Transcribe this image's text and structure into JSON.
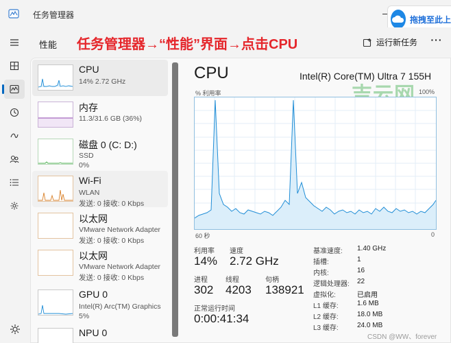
{
  "titlebar": {
    "title": "任务管理器",
    "overlay_text": "拖拽至此上"
  },
  "header": {
    "page_title": "性能",
    "annotation": "任务管理器→“性能”界面→点击CPU",
    "run_task_label": "运行新任务",
    "more_label": "···"
  },
  "nav": [
    {
      "icon": "hamburger-icon"
    },
    {
      "icon": "processes-icon"
    },
    {
      "icon": "performance-icon"
    },
    {
      "icon": "app-history-icon"
    },
    {
      "icon": "startup-icon"
    },
    {
      "icon": "users-icon"
    },
    {
      "icon": "details-icon"
    },
    {
      "icon": "services-icon"
    },
    {
      "icon": "settings-icon"
    }
  ],
  "sidebar": {
    "items": [
      {
        "name": "CPU",
        "line1": "14% 2.72 GHz",
        "line2": "",
        "color": "#1f8dd6"
      },
      {
        "name": "内存",
        "line1": "11.3/31.6 GB (36%)",
        "line2": "",
        "color": "#8e44ad"
      },
      {
        "name": "磁盘 0 (C: D:)",
        "line1": "SSD",
        "line2": "0%",
        "color": "#4caf50"
      },
      {
        "name": "Wi-Fi",
        "line1": "WLAN",
        "line2": "发送: 0 接收: 0 Kbps",
        "color": "#d9822b"
      },
      {
        "name": "以太网",
        "line1": "VMware Network Adapter",
        "line2": "发送: 0 接收: 0 Kbps",
        "color": "#d9822b"
      },
      {
        "name": "以太网",
        "line1": "VMware Network Adapter",
        "line2": "发送: 0 接收: 0 Kbps",
        "color": "#d9822b"
      },
      {
        "name": "GPU 0",
        "line1": "Intel(R) Arc(TM) Graphics",
        "line2": "5%",
        "color": "#1f8dd6"
      },
      {
        "name": "NPU 0",
        "line1": "",
        "line2": "",
        "color": "#1f8dd6"
      }
    ]
  },
  "detail": {
    "title": "CPU",
    "model": "Intel(R) Core(TM) Ultra 7 155H",
    "watermark": "吉云网",
    "util_label": "% 利用率",
    "util_max": "100%",
    "axis_left": "60 秒",
    "axis_right": "0",
    "usage_label": "利用率",
    "usage_value": "14%",
    "speed_label": "速度",
    "speed_value": "2.72 GHz",
    "processes_label": "进程",
    "processes_value": "302",
    "threads_label": "线程",
    "threads_value": "4203",
    "handles_label": "句柄",
    "handles_value": "138921",
    "uptime_label": "正常运行时间",
    "uptime_value": "0:00:41:34",
    "specs": [
      {
        "label": "基准速度:",
        "value": "1.40 GHz"
      },
      {
        "label": "插槽:",
        "value": "1"
      },
      {
        "label": "内核:",
        "value": "16"
      },
      {
        "label": "逻辑处理器:",
        "value": "22"
      },
      {
        "label": "虚拟化:",
        "value": "已启用"
      },
      {
        "label": "L1 缓存:",
        "value": "1.6 MB"
      },
      {
        "label": "L2 缓存:",
        "value": "18.0 MB"
      },
      {
        "label": "L3 缓存:",
        "value": "24.0 MB"
      }
    ]
  },
  "footer_mark": "CSDN @WW、forever",
  "colors": {
    "accent": "#0067c0",
    "cpu_line": "#1f8dd6",
    "annotation": "#e5262b"
  }
}
